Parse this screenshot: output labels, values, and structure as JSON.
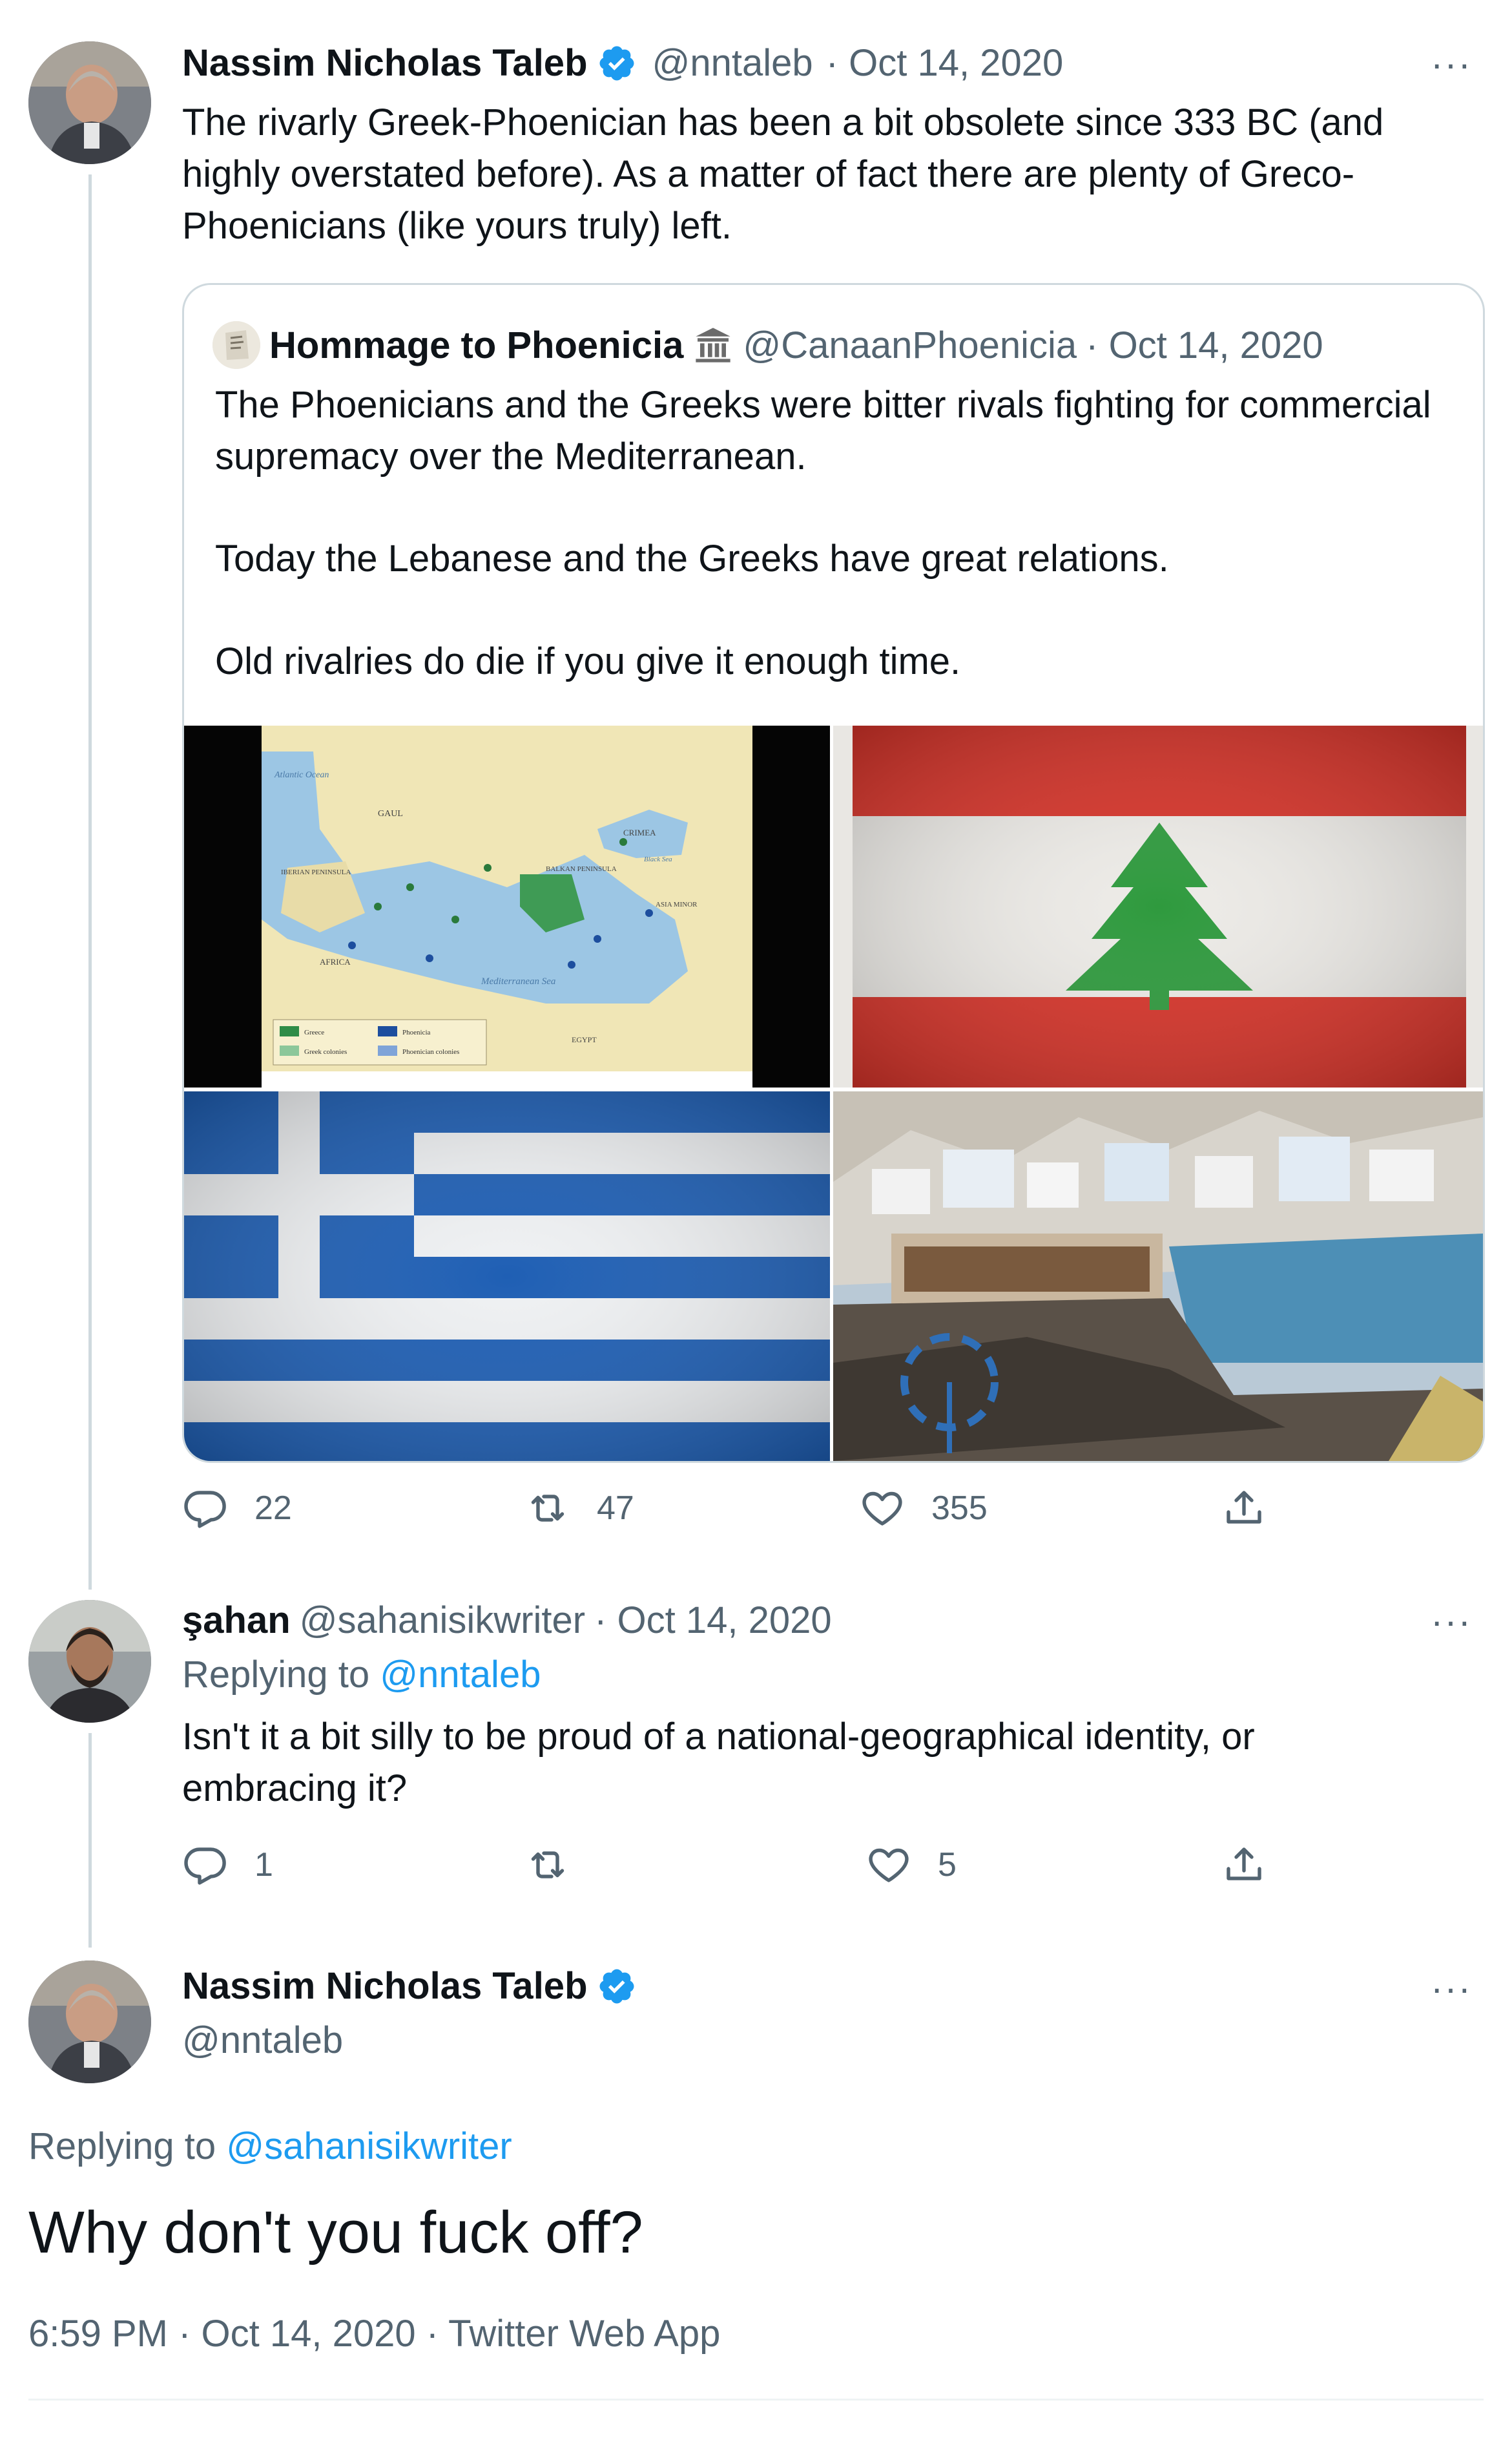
{
  "tweet1": {
    "name": "Nassim Nicholas Taleb",
    "handle": "@nntaleb",
    "date": "· Oct 14, 2020",
    "text": "The rivarly Greek-Phoenician has been a bit obsolete since 333 BC (and highly overstated before). As a matter of fact there are plenty of Greco-Phoenicians (like yours truly) left.",
    "more": "···",
    "quote": {
      "name": "Hommage to Phoenicia",
      "handle": "@CanaanPhoenicia",
      "date": "· Oct 14, 2020",
      "para1": "The Phoenicians and the Greeks were bitter rivals fighting for commercial supremacy over the Mediterranean.",
      "para2": "Today the Lebanese and the Greeks have great relations.",
      "para3": "Old rivalries do die if you give it enough time.",
      "map_labels": {
        "atlantic": "Atlantic Ocean",
        "gaul": "GAUL",
        "iberian": "IBERIAN PENINSULA",
        "crimea": "CRIMEA",
        "black_sea": "Black Sea",
        "balkan": "BALKAN PENINSULA",
        "asia_minor": "ASIA MINOR",
        "africa": "AFRICA",
        "med_sea": "Mediterranean Sea",
        "egypt": "EGYPT",
        "legend_greece": "Greece",
        "legend_greek_colonies": "Greek colonies",
        "legend_phoenicia": "Phoenicia",
        "legend_phoenician_colonies": "Phoenician colonies"
      }
    },
    "stats": {
      "replies": "22",
      "retweets": "47",
      "likes": "355"
    }
  },
  "tweet2": {
    "name": "şahan",
    "handle": "@sahanisikwriter",
    "date": "· Oct 14, 2020",
    "replying_prefix": "Replying to ",
    "replying_to": "@nntaleb",
    "text": "Isn't it a bit silly to be proud of a national-geographical identity, or embracing it?",
    "more": "···",
    "stats": {
      "replies": "1",
      "retweets": "",
      "likes": "5"
    }
  },
  "tweet3": {
    "name": "Nassim Nicholas Taleb",
    "handle": "@nntaleb",
    "replying_prefix": "Replying to ",
    "replying_to": "@sahanisikwriter",
    "text": "Why don't you fuck off?",
    "meta": "6:59 PM · Oct 14, 2020 · Twitter Web App",
    "more": "···"
  },
  "colors": {
    "link": "#1d9bf0",
    "muted": "#536471",
    "greek_blue": "#1f5fb4",
    "lebanon_red": "#d6342a",
    "cedar_green": "#2f9a3e"
  },
  "icons": [
    "verified-badge-icon",
    "reply-icon",
    "retweet-icon",
    "like-icon",
    "share-icon",
    "more-icon",
    "temple-icon"
  ]
}
